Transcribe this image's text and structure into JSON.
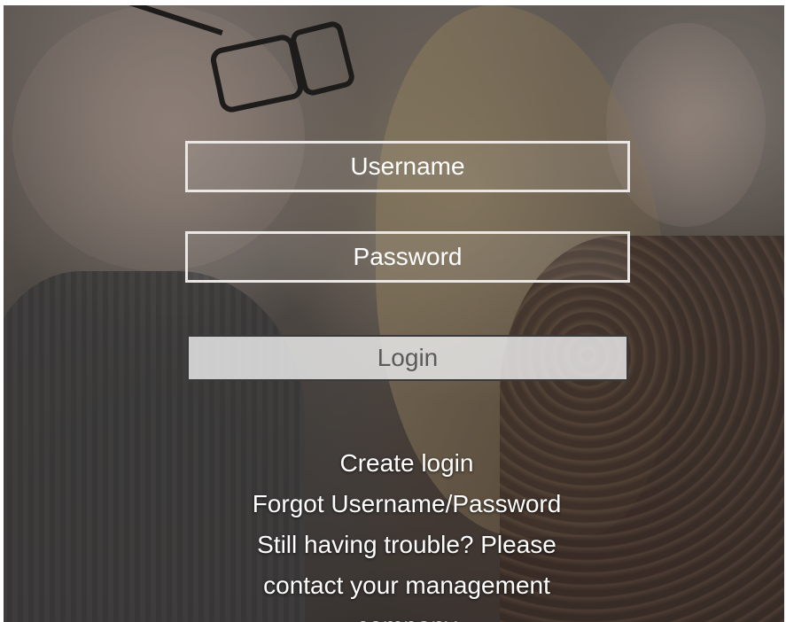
{
  "login_form": {
    "username_placeholder": "Username",
    "password_placeholder": "Password",
    "login_label": "Login"
  },
  "links": {
    "create_login": "Create login",
    "forgot": "Forgot Username/Password",
    "trouble_line1": "Still having trouble? Please",
    "trouble_line2": "contact your management",
    "trouble_line3": "company"
  },
  "colors": {
    "field_border": "#e9e6e3",
    "button_bg": "#e8e8e8",
    "button_text": "#5a5a5a",
    "text": "#ffffff"
  }
}
